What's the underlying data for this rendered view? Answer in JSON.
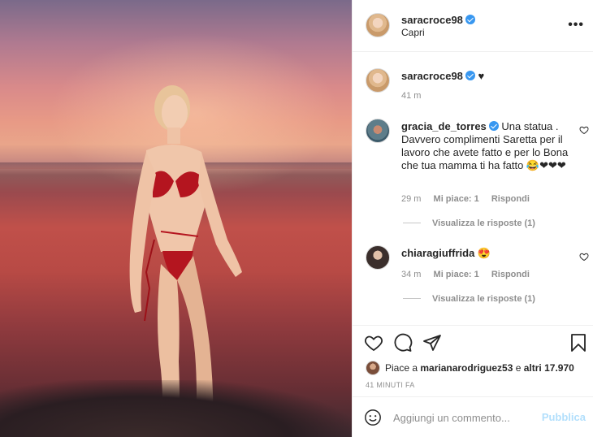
{
  "post": {
    "author": "saracroce98",
    "location": "Capri"
  },
  "caption": {
    "username": "saracroce98",
    "text": "♥",
    "time": "41 m"
  },
  "comments": [
    {
      "username": "gracia_de_torres",
      "text": "Una statua . Davvero complimenti Saretta per il lavoro che avete fatto e per lo Bona che tua mamma ti ha fatto 😂❤❤❤",
      "time": "29 m",
      "likes": "Mi piace: 1",
      "reply": "Rispondi",
      "view_replies": "Visualizza le risposte (1)"
    },
    {
      "username": "chiaragiuffrida",
      "text": "😍",
      "time": "34 m",
      "likes": "Mi piace: 1",
      "reply": "Rispondi",
      "view_replies": "Visualizza le risposte (1)"
    }
  ],
  "likes": {
    "prefix": "Piace a ",
    "user": "marianarodriguez53",
    "middle": " e ",
    "others": "altri 17.970"
  },
  "posted": "41 MINUTI FA",
  "comment_box": {
    "placeholder": "Aggiungi un commento...",
    "publish": "Pubblica"
  },
  "header": {
    "more": "•••"
  },
  "icons": {
    "like": "heart-icon",
    "comment": "comment-icon",
    "share": "paper-plane-icon",
    "save": "bookmark-icon",
    "emoji": "smiley-icon",
    "verified": "verified-badge-icon"
  },
  "colors": {
    "verified": "#3897f0",
    "publish_disabled": "#b2dffc",
    "muted": "#8e8e8e"
  }
}
